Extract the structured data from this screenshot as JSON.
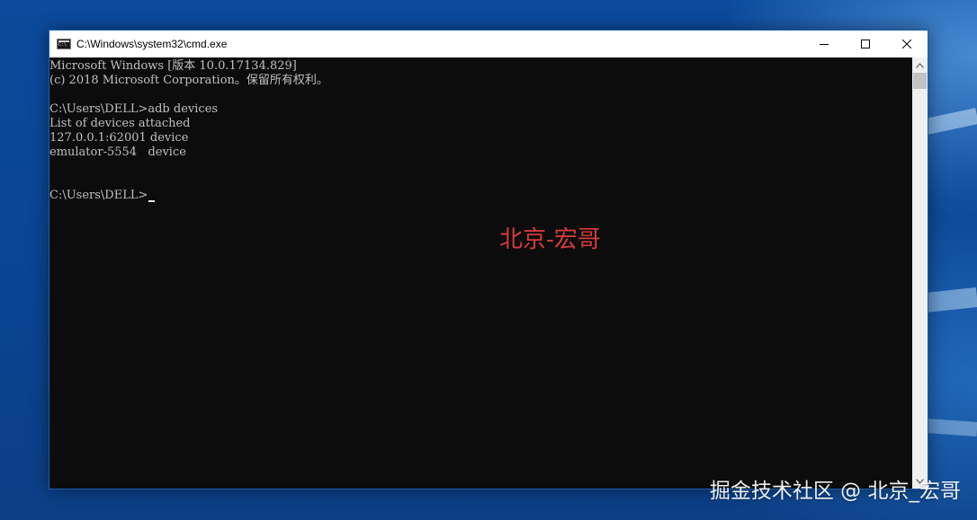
{
  "window": {
    "title": "C:\\Windows\\system32\\cmd.exe",
    "icon": "console-app-icon",
    "controls": {
      "minimize_icon": "minimize-icon",
      "maximize_icon": "maximize-icon",
      "close_icon": "close-icon"
    }
  },
  "console": {
    "lines": [
      "Microsoft Windows [版本 10.0.17134.829]",
      "(c) 2018 Microsoft Corporation。保留所有权利。",
      "",
      "C:\\Users\\DELL>adb devices",
      "List of devices attached",
      "127.0.0.1:62001 device",
      "emulator-5554   device",
      "",
      "",
      "C:\\Users\\DELL>"
    ],
    "text_color": "#c0c0c0",
    "background_color": "#0c0c0c"
  },
  "overlay": {
    "author_label": "北京-宏哥",
    "author_color": "#d63b3b"
  },
  "footer": {
    "watermark": "掘金技术社区 @ 北京_宏哥"
  }
}
